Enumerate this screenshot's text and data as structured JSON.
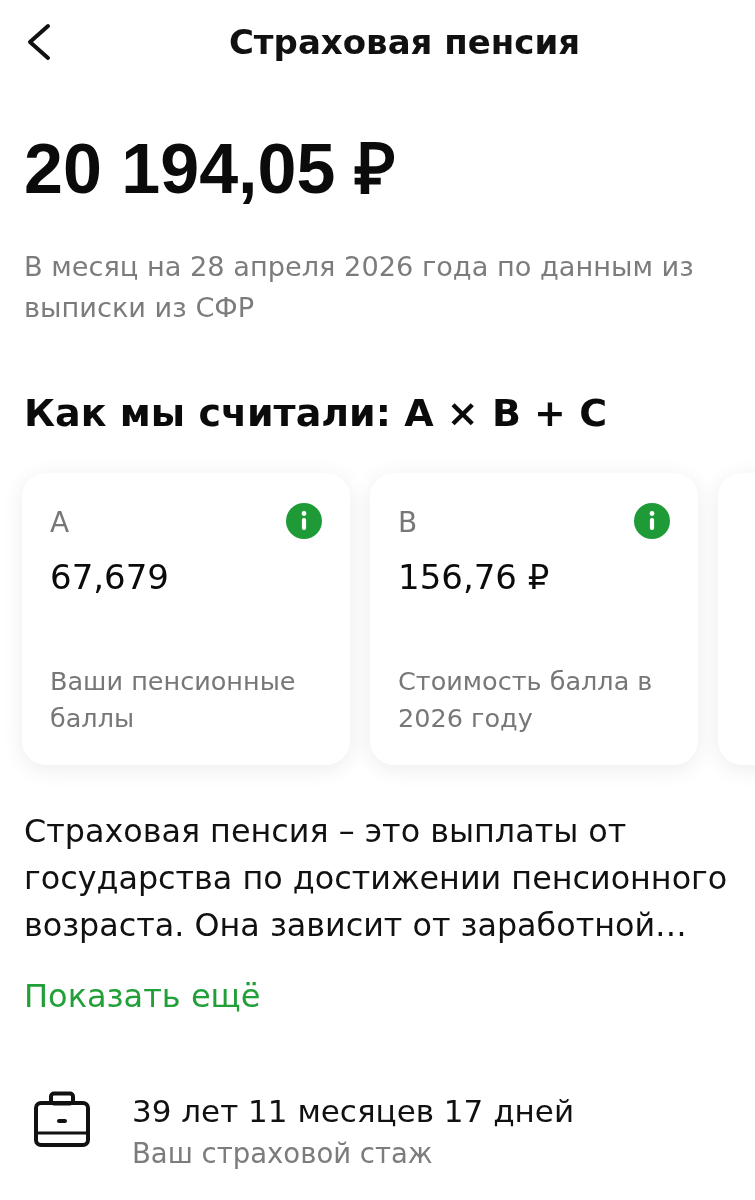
{
  "header": {
    "title": "Страховая пенсия"
  },
  "amount": "20 194,05 ₽",
  "amount_note": "В месяц на 28 апреля 2026 года по данным из выписки из СФР",
  "formula": {
    "title": "Как мы считали: А × В + С"
  },
  "cards": [
    {
      "kind": "full",
      "label": "А",
      "value": "67,679",
      "description": "Ваши пенсионные баллы",
      "info": true
    },
    {
      "kind": "full",
      "label": "В",
      "value": "156,76 ₽",
      "description": "Стоимость балла в 2026 году",
      "info": true
    },
    {
      "kind": "clipped"
    }
  ],
  "description": {
    "text": "Страховая пенсия – это выплаты от государства по достижении пенсионного возраста. Она зависит от заработной…",
    "more_link": "Показать ещё"
  },
  "insurance_period": {
    "value": "39 лет 11 месяцев 17 дней",
    "caption": "Ваш страховой стаж"
  }
}
